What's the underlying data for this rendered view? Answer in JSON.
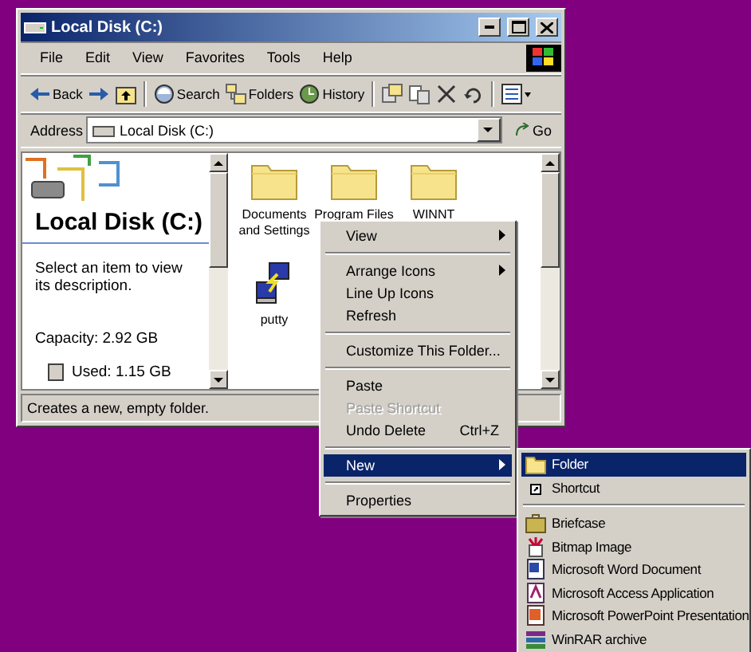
{
  "window": {
    "title": "Local Disk (C:)"
  },
  "menu_bar": [
    "File",
    "Edit",
    "View",
    "Favorites",
    "Tools",
    "Help"
  ],
  "toolbar": [
    {
      "kind": "back",
      "label": "Back"
    },
    {
      "kind": "forward"
    },
    {
      "kind": "up"
    },
    {
      "kind": "search",
      "label": "Search"
    },
    {
      "kind": "folders",
      "label": "Folders"
    },
    {
      "kind": "history",
      "label": "History"
    },
    {
      "kind": "move"
    },
    {
      "kind": "copy"
    },
    {
      "kind": "delete"
    },
    {
      "kind": "undo"
    },
    {
      "kind": "views"
    }
  ],
  "address": {
    "label": "Address",
    "value": "Local Disk (C:)",
    "go": "Go"
  },
  "info_panel": {
    "heading": "Local Disk (C:)",
    "description": "Select an item to view its description.",
    "capacity": "Capacity: 2.92 GB",
    "used": "Used: 1.15 GB"
  },
  "files": [
    {
      "name": "Documents and Settings",
      "kind": "folder"
    },
    {
      "name": "Program Files",
      "kind": "folder"
    },
    {
      "name": "WINNT",
      "kind": "folder"
    },
    {
      "name": "putty",
      "kind": "program"
    }
  ],
  "status_bar": "Creates a new, empty folder.",
  "context_menu": [
    {
      "kind": "item",
      "label": "View",
      "submenu": true,
      "disabled": false,
      "selected": false
    },
    {
      "kind": "separator"
    },
    {
      "kind": "item",
      "label": "Arrange Icons",
      "submenu": true,
      "disabled": false,
      "selected": false
    },
    {
      "kind": "item",
      "label": "Line Up Icons",
      "submenu": false,
      "disabled": false,
      "selected": false
    },
    {
      "kind": "item",
      "label": "Refresh",
      "submenu": false,
      "disabled": false,
      "selected": false
    },
    {
      "kind": "separator"
    },
    {
      "kind": "item",
      "label": "Customize This Folder...",
      "submenu": false,
      "disabled": false,
      "selected": false
    },
    {
      "kind": "separator"
    },
    {
      "kind": "item",
      "label": "Paste",
      "submenu": false,
      "disabled": false,
      "selected": false
    },
    {
      "kind": "item",
      "label": "Paste Shortcut",
      "submenu": false,
      "disabled": true,
      "selected": false
    },
    {
      "kind": "item",
      "label": "Undo Delete",
      "shortcut": "Ctrl+Z",
      "submenu": false,
      "disabled": false,
      "selected": false
    },
    {
      "kind": "separator"
    },
    {
      "kind": "item",
      "label": "New",
      "submenu": true,
      "disabled": false,
      "selected": true
    },
    {
      "kind": "separator"
    },
    {
      "kind": "item",
      "label": "Properties",
      "submenu": false,
      "disabled": false,
      "selected": false
    }
  ],
  "new_submenu": [
    {
      "kind": "item",
      "label": "Folder",
      "selected": true
    },
    {
      "kind": "item",
      "label": "Shortcut",
      "selected": false
    },
    {
      "kind": "separator"
    },
    {
      "kind": "item",
      "label": "Briefcase",
      "selected": false
    },
    {
      "kind": "item",
      "label": "Bitmap Image",
      "selected": false
    },
    {
      "kind": "item",
      "label": "Microsoft Word Document",
      "selected": false
    },
    {
      "kind": "item",
      "label": "Microsoft Access Application",
      "selected": false
    },
    {
      "kind": "item",
      "label": "Microsoft PowerPoint Presentation",
      "selected": false
    },
    {
      "kind": "item",
      "label": "WinRAR archive",
      "selected": false
    }
  ]
}
